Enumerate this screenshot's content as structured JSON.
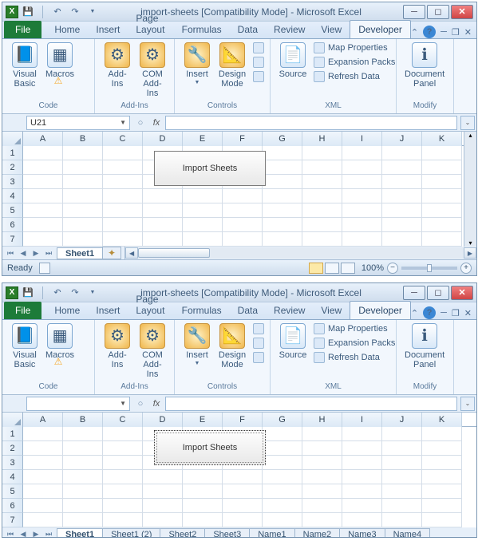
{
  "win1": {
    "title": "import-sheets  [Compatibility Mode]  -  Microsoft Excel",
    "tabs": {
      "file": "File",
      "items": [
        "Home",
        "Insert",
        "Page Layout",
        "Formulas",
        "Data",
        "Review",
        "View",
        "Developer"
      ],
      "active": 7
    },
    "ribbon": {
      "visualbasic": "Visual\nBasic",
      "macros": "Macros",
      "code": "Code",
      "addins": "Add-Ins",
      "comaddins": "COM\nAdd-Ins",
      "addinsg": "Add-Ins",
      "insert": "Insert",
      "design": "Design\nMode",
      "controls": "Controls",
      "source": "Source",
      "mapprops": "Map Properties",
      "expansion": "Expansion Packs",
      "refresh": "Refresh Data",
      "xml": "XML",
      "docpanel": "Document\nPanel",
      "modify": "Modify"
    },
    "namebox": "U21",
    "cols": [
      "A",
      "B",
      "C",
      "D",
      "E",
      "F",
      "G",
      "H",
      "I",
      "J",
      "K"
    ],
    "rows": [
      "1",
      "2",
      "3",
      "4",
      "5",
      "6",
      "7"
    ],
    "button": "Import Sheets",
    "sheets": [
      "Sheet1"
    ],
    "status": "Ready",
    "zoom": "100%"
  },
  "win2": {
    "title": "import-sheets  [Compatibility Mode]  -  Microsoft Excel",
    "tabs": {
      "file": "File",
      "items": [
        "Home",
        "Insert",
        "Page Layout",
        "Formulas",
        "Data",
        "Review",
        "View",
        "Developer"
      ],
      "active": 7
    },
    "ribbon": {
      "visualbasic": "Visual\nBasic",
      "macros": "Macros",
      "code": "Code",
      "addins": "Add-Ins",
      "comaddins": "COM\nAdd-Ins",
      "addinsg": "Add-Ins",
      "insert": "Insert",
      "design": "Design\nMode",
      "controls": "Controls",
      "source": "Source",
      "mapprops": "Map Properties",
      "expansion": "Expansion Packs",
      "refresh": "Refresh Data",
      "xml": "XML",
      "docpanel": "Document\nPanel",
      "modify": "Modify"
    },
    "namebox": "",
    "cols": [
      "A",
      "B",
      "C",
      "D",
      "E",
      "F",
      "G",
      "H",
      "I",
      "J",
      "K"
    ],
    "rows": [
      "1",
      "2",
      "3",
      "4",
      "5",
      "6",
      "7"
    ],
    "button": "Import Sheets",
    "sheets": [
      "Sheet1",
      "Sheet1 (2)",
      "Sheet2",
      "Sheet3",
      "Name1",
      "Name2",
      "Name3",
      "Name4"
    ]
  }
}
